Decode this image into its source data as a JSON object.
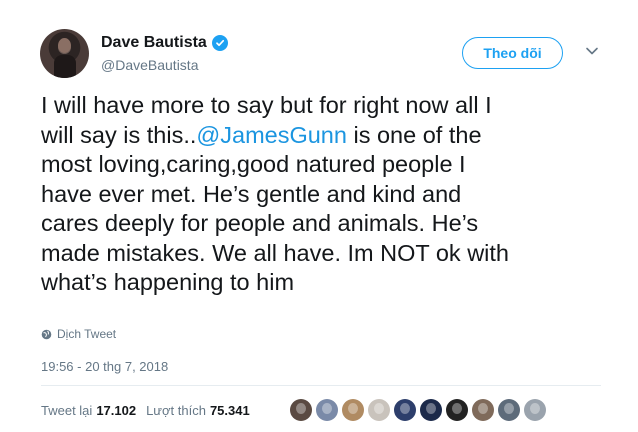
{
  "author": {
    "name": "Dave Bautista",
    "handle": "@DaveBautista",
    "verified": true,
    "avatar_icon": "profile-photo"
  },
  "follow_button": {
    "label": "Theo dõi"
  },
  "menu": {
    "icon": "chevron-down-icon"
  },
  "tweet": {
    "lines": [
      "I will have more to say but for right now all I",
      "will say is this..",
      "is one of the",
      "most loving,caring,good natured people I",
      "have ever met. He’s gentle and kind and",
      "cares deeply for people and animals. He’s",
      "made mistakes. We all have. Im NOT ok with",
      "what’s happening to him"
    ],
    "mention": "@JamesGunn"
  },
  "translate": {
    "label": "Dịch Tweet",
    "icon": "globe-icon"
  },
  "timestamp": "19:56 - 20 thg 7, 2018",
  "stats": {
    "retweets_label": "Tweet lại",
    "retweets": "17.102",
    "likes_label": "Lượt thích",
    "likes": "75.341"
  },
  "liker_avatars": [
    {
      "color": "#5a4a42"
    },
    {
      "color": "#7a8aa8"
    },
    {
      "color": "#b08b62"
    },
    {
      "color": "#c9c3bc"
    },
    {
      "color": "#2d3e6b"
    },
    {
      "color": "#1c2a4a"
    },
    {
      "color": "#222222"
    },
    {
      "color": "#7f6a5a"
    },
    {
      "color": "#5d6b7a"
    },
    {
      "color": "#9aa3ad"
    }
  ],
  "colors": {
    "accent": "#1da1f2",
    "mention": "#1b95e0",
    "muted": "#657786",
    "text": "#14171a"
  }
}
